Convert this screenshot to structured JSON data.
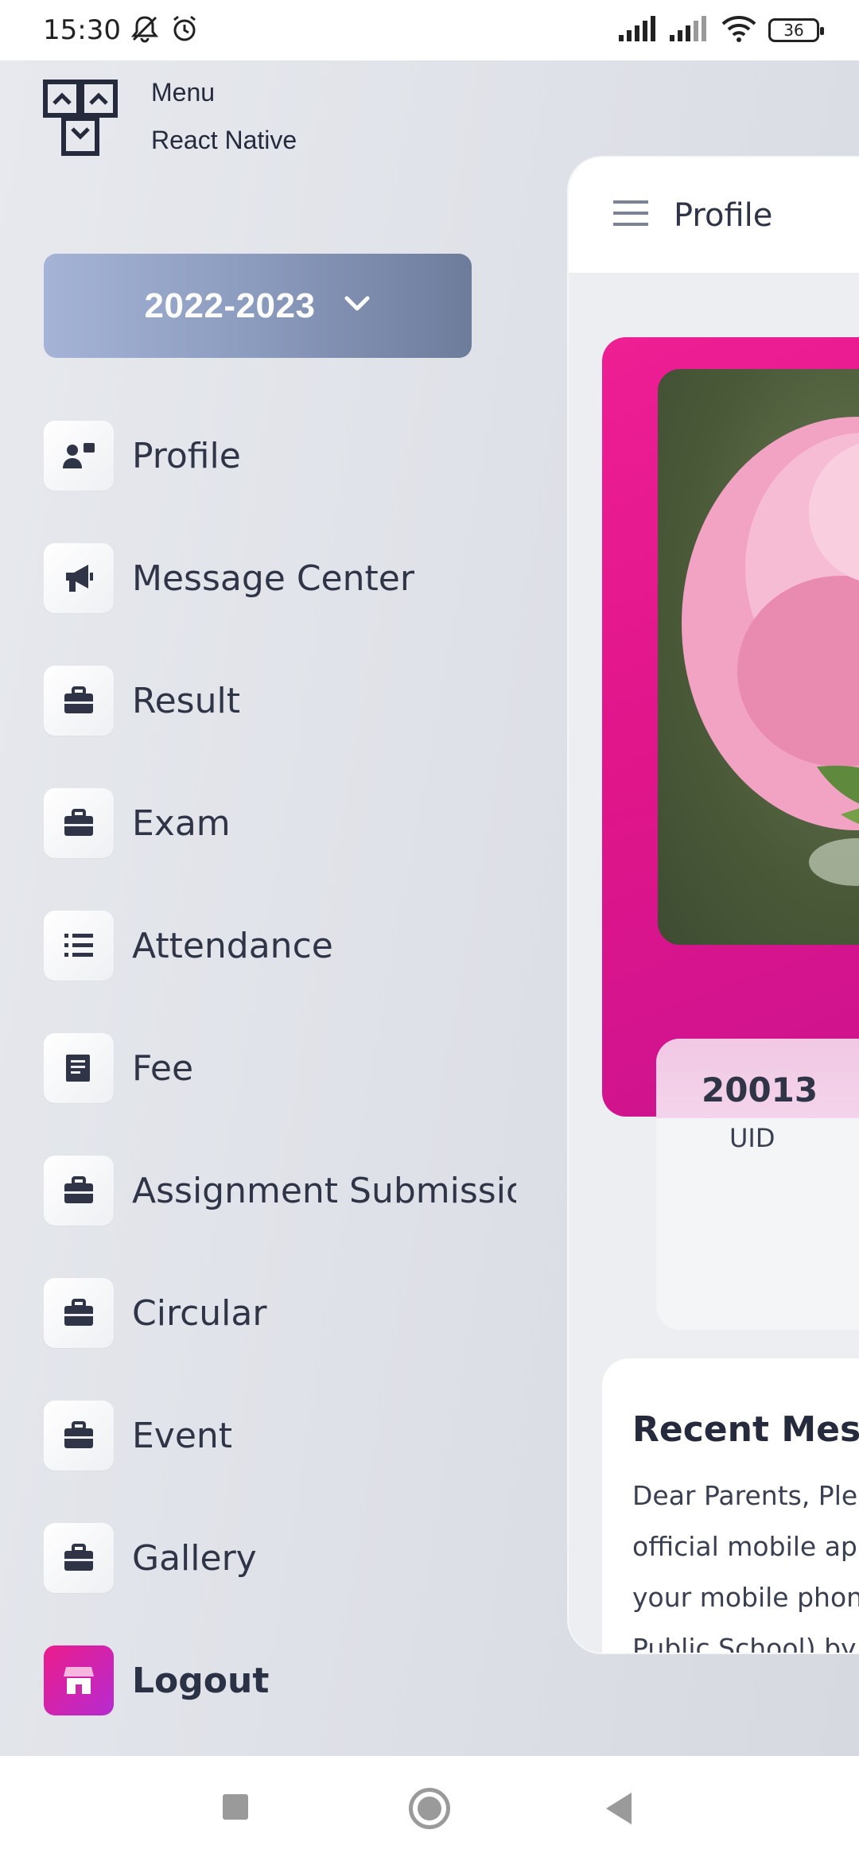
{
  "status_bar": {
    "time": "15:30",
    "battery": "36",
    "icons": [
      "bell-muted-icon",
      "alarm-icon",
      "signal-icon",
      "signal-icon",
      "wifi-icon",
      "battery-icon"
    ]
  },
  "drawer": {
    "brand_title": "Menu",
    "brand_subtitle": "React Native",
    "year": "2022-2023",
    "items": [
      {
        "label": "Profile",
        "icon": "user-card-icon"
      },
      {
        "label": "Message Center",
        "icon": "megaphone-icon"
      },
      {
        "label": "Result",
        "icon": "briefcase-icon"
      },
      {
        "label": "Exam",
        "icon": "briefcase-icon"
      },
      {
        "label": "Attendance",
        "icon": "list-icon"
      },
      {
        "label": "Fee",
        "icon": "receipt-icon"
      },
      {
        "label": "Assignment Submission",
        "icon": "briefcase-icon"
      },
      {
        "label": "Circular",
        "icon": "briefcase-icon"
      },
      {
        "label": "Event",
        "icon": "briefcase-icon"
      },
      {
        "label": "Gallery",
        "icon": "briefcase-icon"
      },
      {
        "label": "Logout",
        "icon": "store-icon"
      }
    ]
  },
  "main": {
    "header_title": "Profile",
    "uid_value": "20013",
    "uid_label": "UID",
    "recent_messages_title": "Recent Messa",
    "message_lines": [
      "Dear Parents, Plea",
      "official mobile app",
      "your mobile phon",
      "Public School) by F"
    ]
  },
  "colors": {
    "accent_pink": "#e0158a",
    "year_button_start": "#a4b3d6",
    "year_button_end": "#6e7c9c",
    "text_dark": "#2f3547"
  }
}
